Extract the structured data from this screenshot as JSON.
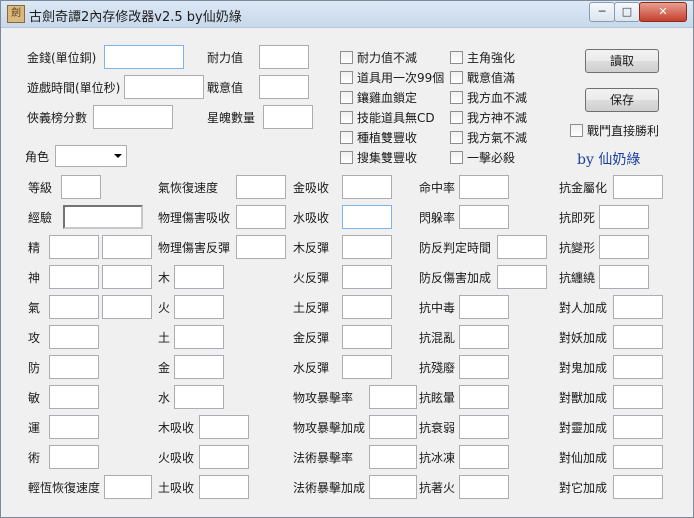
{
  "window": {
    "title": "古劍奇譚2內存修改器v2.5 by仙奶綠",
    "icon_glyph": "劍",
    "controls": {
      "minimize": "─",
      "maximize": "□",
      "close": "✕"
    }
  },
  "top": {
    "money_label": "金錢(單位銅)",
    "time_label": "遊戲時間(單位秒)",
    "chivalry_label": "俠義榜分數",
    "stamina_label": "耐力值",
    "battle_will_label": "戰意值",
    "star_soul_label": "星魄數量",
    "role_label": "角色"
  },
  "cheats": {
    "col1": [
      "耐力值不減",
      "道具用一次99個",
      "鑲雞血鎖定",
      "技能道具無CD",
      "種植雙豐收",
      "搜集雙豐收"
    ],
    "col2": [
      "主角強化",
      "戰意值滿",
      "我方血不減",
      "我方神不減",
      "我方氣不減",
      "一擊必殺"
    ],
    "direct_win": "戰鬥直接勝利"
  },
  "buttons": {
    "read": "讀取",
    "save": "保存"
  },
  "author": "by 仙奶綠",
  "stats": {
    "col1": [
      "等級",
      "經驗",
      "精",
      "神",
      "氣",
      "攻",
      "防",
      "敏",
      "運",
      "術",
      "輕恆恢復速度"
    ],
    "col2": [
      "氣恢復速度",
      "物理傷害吸收",
      "物理傷害反彈",
      "木",
      "火",
      "土",
      "金",
      "水",
      "木吸收",
      "火吸收",
      "土吸收"
    ],
    "col3": [
      "金吸收",
      "水吸收",
      "木反彈",
      "火反彈",
      "土反彈",
      "金反彈",
      "水反彈",
      "物攻暴擊率",
      "物攻暴擊加成",
      "法術暴擊率",
      "法術暴擊加成"
    ],
    "col4": [
      "命中率",
      "閃躲率",
      "防反判定時間",
      "防反傷害加成",
      "抗中毒",
      "抗混亂",
      "抗殘廢",
      "抗眩暈",
      "抗衰弱",
      "抗冰凍",
      "抗著火"
    ],
    "col5": [
      "抗金屬化",
      "抗即死",
      "抗變形",
      "抗纏繞",
      "對人加成",
      "對妖加成",
      "對鬼加成",
      "對獸加成",
      "對靈加成",
      "對仙加成",
      "對它加成"
    ]
  }
}
